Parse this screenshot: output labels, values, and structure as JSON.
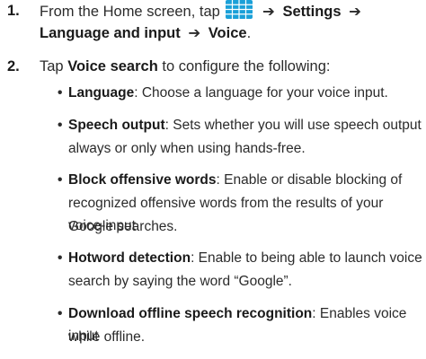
{
  "steps": [
    {
      "number": "1.",
      "line1_text": "From the Home screen, tap",
      "apps_icon": "apps-grid-icon",
      "arrow": "➔",
      "settings": "Settings",
      "language_input": "Language and input",
      "voice": "Voice"
    },
    {
      "number": "2.",
      "text_before": "Tap ",
      "bold": "Voice search",
      "text_after": " to configure the following:"
    }
  ],
  "bullets": [
    {
      "dot": "•",
      "term": "Language",
      "line1": ": Choose a language for your voice input."
    },
    {
      "dot": "•",
      "term": "Speech output",
      "line1": ": Sets whether you will use speech output",
      "line2": "always or only when using hands-free."
    },
    {
      "dot": "•",
      "term": "Block offensive words",
      "line1": ": Enable or disable blocking of",
      "line2": "recognized offensive words from the results of your voice-input",
      "line3": "Google searches."
    },
    {
      "dot": "•",
      "term": "Hotword detection",
      "line1": ": Enable to being able to launch voice",
      "line2": "search by saying the word “Google”."
    },
    {
      "dot": "•",
      "term": "Download offline speech recognition",
      "line1": ": Enables voice input",
      "line2": "while offline."
    }
  ],
  "colors": {
    "watermark": "#ececec",
    "icon_bg": "#1aa0d8"
  }
}
